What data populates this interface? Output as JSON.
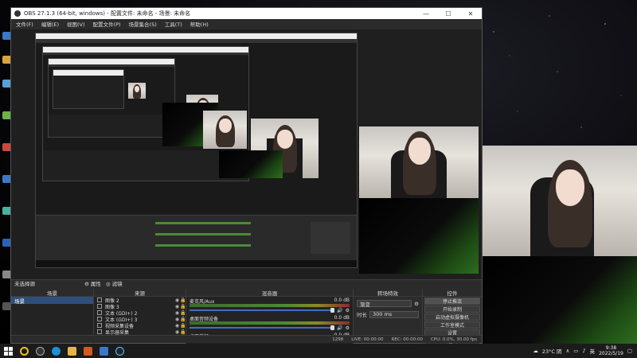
{
  "window": {
    "title": "OBS 27.1.3 (64-bit, windows) - 配置文件: 未命名 - 场景: 未命名",
    "minimize": "—",
    "maximize": "☐",
    "close": "✕"
  },
  "menu": [
    "文件(F)",
    "编辑(E)",
    "视图(V)",
    "配置文件(P)",
    "场景集合(S)",
    "工具(T)",
    "帮助(H)"
  ],
  "docks": {
    "scenes_header": "场景",
    "sources_header": "来源",
    "mixer_header": "混音器",
    "transitions_header": "转场特效",
    "controls_header": "控件",
    "no_source_selected": "未选择源",
    "properties_btn": "属性",
    "filters_btn": "滤镜"
  },
  "scenes": [
    "场景"
  ],
  "sources": [
    {
      "label": "图像 2",
      "icon": "image-icon"
    },
    {
      "label": "图像 3",
      "icon": "image-icon"
    },
    {
      "label": "文本 (GDI+) 2",
      "icon": "text-icon"
    },
    {
      "label": "文本 (GDI+) 3",
      "icon": "text-icon"
    },
    {
      "label": "视频采集设备",
      "icon": "camera-icon"
    },
    {
      "label": "显示器采集",
      "icon": "monitor-icon"
    }
  ],
  "mixer": [
    {
      "name": "麦克风/Aux",
      "level": "0.0 dB"
    },
    {
      "name": "桌面音频设备",
      "level": "0.0 dB"
    },
    {
      "name": "桌面音频",
      "level": "-0.0 dB"
    }
  ],
  "transitions": {
    "type": "渐变",
    "duration_label": "时长",
    "duration": "300 ms"
  },
  "controls": [
    "停止推流",
    "开始录制",
    "启动虚拟摄像机",
    "工作室模式",
    "设置",
    "退出"
  ],
  "status": {
    "live": "LIVE: 00:00:00",
    "rec": "REC: 00:00:00",
    "cpu": "CPU: 0.0%, 30.00 fps",
    "dropped": "1298"
  },
  "taskbar": {
    "weather": "23°C 阴",
    "time": "9:38",
    "date": "2022/5/19",
    "lang": "英"
  },
  "colors": {
    "obs_bg": "#2b2b2b",
    "selection": "#2f4f7a",
    "meter_green": "#4d8a36",
    "volume_blue": "#3e6ec4"
  }
}
